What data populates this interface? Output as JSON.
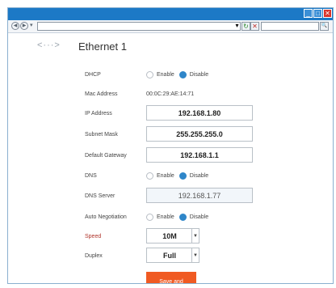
{
  "window": {
    "minimize_glyph": "_",
    "maximize_glyph": "□",
    "close_glyph": "✕"
  },
  "toolbar": {
    "back_glyph": "◀",
    "forward_glyph": "▶",
    "dropdown_glyph": "▾",
    "go_glyph": "▾",
    "refresh_glyph": "↻",
    "stop_glyph": "✕",
    "search_glyph": "🔍"
  },
  "page": {
    "back_arrow": "<···>",
    "title": "Ethernet 1"
  },
  "fields": {
    "dhcp": {
      "label": "DHCP",
      "enable": "Enable",
      "disable": "Disable",
      "selected": "Disable"
    },
    "mac": {
      "label": "Mac Address",
      "value": "00:0C:29:AE:14:71"
    },
    "ip": {
      "label": "IP Address",
      "value": "192.168.1.80"
    },
    "subnet": {
      "label": "Subnet Mask",
      "value": "255.255.255.0"
    },
    "gateway": {
      "label": "Default Gateway",
      "value": "192.168.1.1"
    },
    "dns": {
      "label": "DNS",
      "enable": "Enable",
      "disable": "Disable",
      "selected": "Disable"
    },
    "dns_server": {
      "label": "DNS Server",
      "value": "192.168.1.77"
    },
    "autoneg": {
      "label": "Auto Negotiation",
      "enable": "Enable",
      "disable": "Disable",
      "selected": "Disable"
    },
    "speed": {
      "label": "Speed",
      "value": "10M"
    },
    "duplex": {
      "label": "Duplex",
      "value": "Full"
    }
  },
  "actions": {
    "save_label": "Save and Reboot"
  },
  "colors": {
    "titlebar": "#1c79c6",
    "accent": "#2f86c9",
    "save_button": "#f05a22"
  }
}
